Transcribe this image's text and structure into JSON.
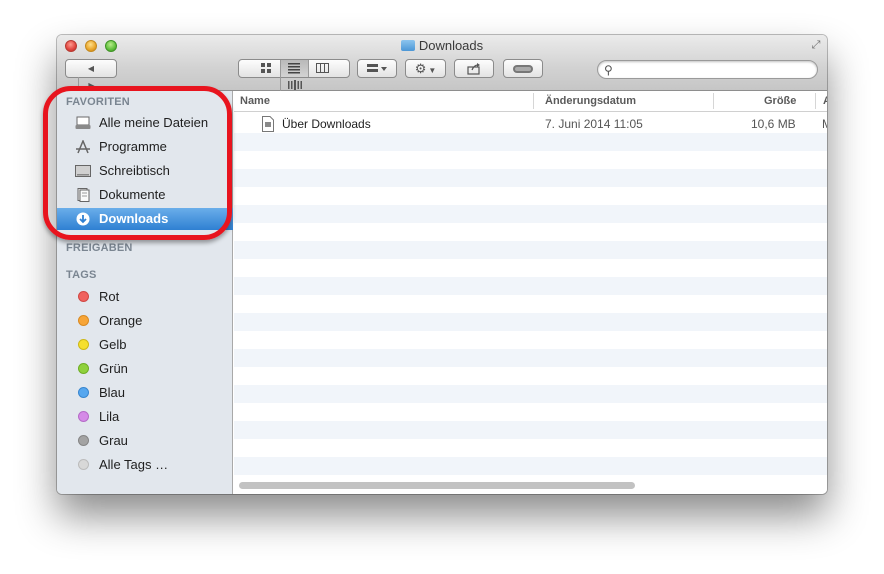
{
  "window": {
    "title": "Downloads"
  },
  "toolbar": {
    "back_icon": "◀",
    "forward_icon": "▶",
    "view_icons": [
      "icon-view-icon",
      "list-view-icon",
      "column-view-icon",
      "coverflow-view-icon"
    ],
    "arrange_icon": "arrange-icon",
    "action_icon": "gear-icon",
    "share_icon": "share-icon",
    "tag_icon": "tag-icon",
    "search_placeholder": ""
  },
  "sidebar": {
    "favorites_header": "FAVORITEN",
    "favorites": [
      {
        "label": "Alle meine Dateien",
        "icon": "all-files-icon"
      },
      {
        "label": "Programme",
        "icon": "applications-icon"
      },
      {
        "label": "Schreibtisch",
        "icon": "desktop-icon"
      },
      {
        "label": "Dokumente",
        "icon": "documents-icon"
      },
      {
        "label": "Downloads",
        "icon": "downloads-icon",
        "selected": true
      }
    ],
    "shared_header": "FREIGABEN",
    "tags_header": "TAGS",
    "tags": [
      {
        "label": "Rot",
        "color": "#f0625e"
      },
      {
        "label": "Orange",
        "color": "#f7a537"
      },
      {
        "label": "Gelb",
        "color": "#f5df2e"
      },
      {
        "label": "Grün",
        "color": "#8fd13c"
      },
      {
        "label": "Blau",
        "color": "#56a7ef"
      },
      {
        "label": "Lila",
        "color": "#d58ae7"
      },
      {
        "label": "Grau",
        "color": "#a3a3a3"
      },
      {
        "label": "Alle Tags …",
        "color": "#d8d8d8"
      }
    ]
  },
  "list": {
    "columns": [
      "Name",
      "Änderungsdatum",
      "Größe",
      "A"
    ],
    "rows": [
      {
        "name": "Über Downloads",
        "date": "7. Juni 2014 11:05",
        "size": "10,6 MB",
        "kind": "M"
      }
    ]
  },
  "colors": {
    "selection": "#3a8ad8",
    "highlight_ring": "#e8141e"
  }
}
